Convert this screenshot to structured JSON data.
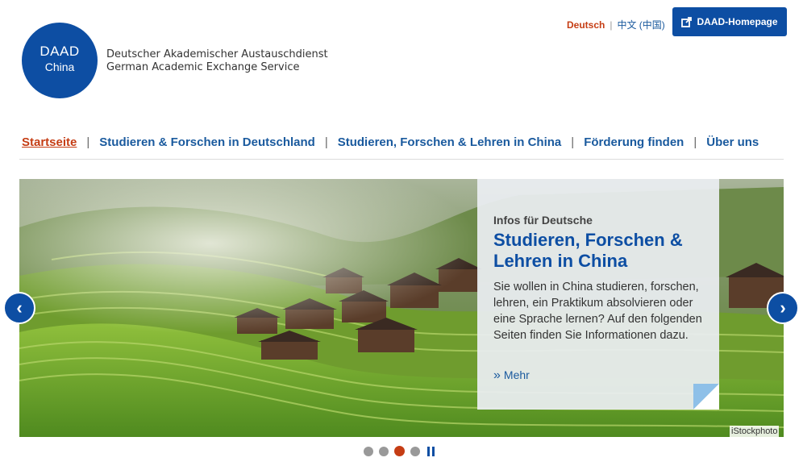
{
  "logo": {
    "line1": "DAAD",
    "line2": "China"
  },
  "org": {
    "de": "Deutscher Akademischer Austauschdienst",
    "en": "German Academic Exchange Service"
  },
  "lang": {
    "de": "Deutsch",
    "sep": "|",
    "zh": "中文 (中国)"
  },
  "homepage_button": {
    "icon": "external-link-icon",
    "label": "DAAD-Homepage"
  },
  "nav": {
    "items": [
      {
        "label": "Startseite",
        "active": true
      },
      {
        "label": "Studieren & Forschen in Deutschland"
      },
      {
        "label": "Studieren, Forschen & Lehren in China"
      },
      {
        "label": "Förderung finden"
      },
      {
        "label": "Über uns"
      }
    ],
    "separator": "|"
  },
  "slide": {
    "kicker": "Infos für Deutsche",
    "title": "Studieren, Forschen & Lehren in China",
    "body": "Sie wollen in China studieren, forschen, lehren, ein Praktikum absolvieren oder eine Sprache lernen? Auf den folgenden Seiten finden Sie Informationen dazu.",
    "more_icon": "double-chevron-right-icon",
    "more": "Mehr",
    "credit": "iStockphoto"
  },
  "carousel": {
    "slide_count": 4,
    "active_index": 2
  },
  "colors": {
    "brand_blue": "#0d4ea3",
    "accent_red": "#c53d14"
  }
}
